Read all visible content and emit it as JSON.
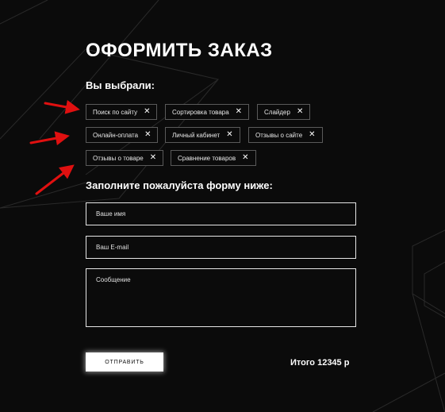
{
  "page_title": "ОФОРМИТЬ ЗАКАЗ",
  "selected_heading": "Вы выбрали:",
  "chips": [
    {
      "label": "Поиск по сайту"
    },
    {
      "label": "Сортировка товара"
    },
    {
      "label": "Слайдер"
    },
    {
      "label": "Онлайн-оплата"
    },
    {
      "label": "Личный кабинет"
    },
    {
      "label": "Отзывы о сайте"
    },
    {
      "label": "Отзывы о товаре"
    },
    {
      "label": "Сравнение товаров"
    }
  ],
  "chip_close_glyph": "✕",
  "form_heading": "Заполните пожалуйста форму ниже:",
  "form": {
    "name_placeholder": "Ваше имя",
    "email_placeholder": "Ваш E-mail",
    "message_placeholder": "Сообщение"
  },
  "submit_label": "ОТПРАВИТЬ",
  "total_text": "Итого 12345 р",
  "colors": {
    "background": "#0b0b0b",
    "text": "#ffffff",
    "chip_border": "#5a5a5a",
    "annotation_arrow": "#e01010"
  }
}
